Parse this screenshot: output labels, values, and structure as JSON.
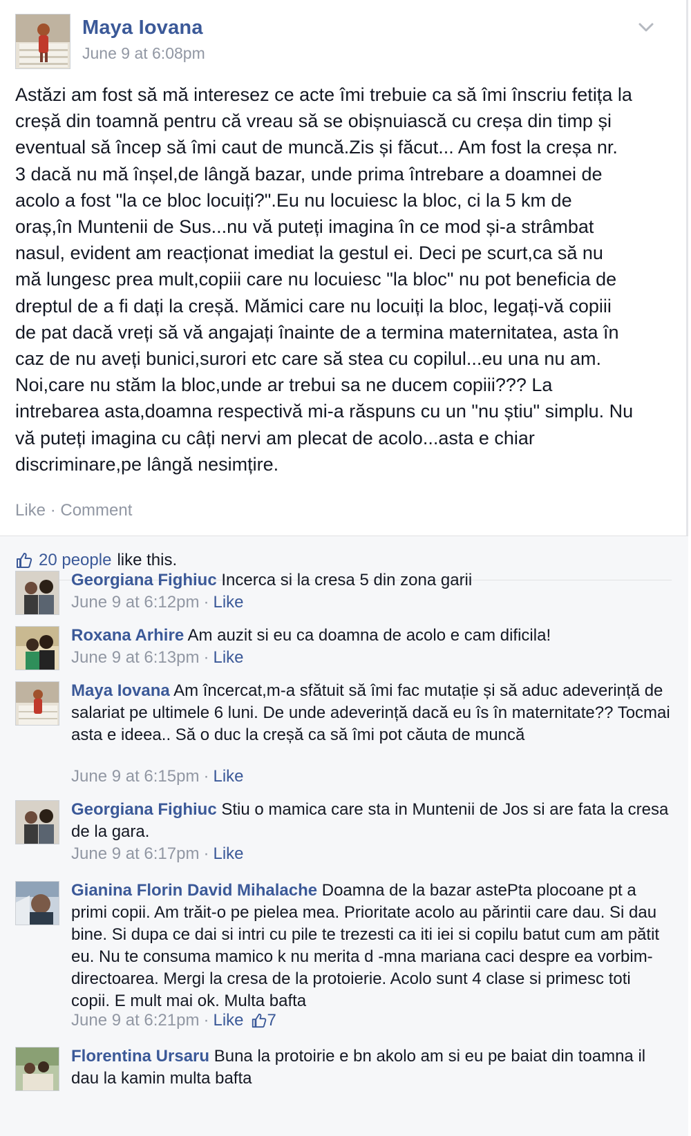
{
  "post": {
    "author": "Maya Iovana",
    "timestamp": "June 9 at 6:08pm",
    "text": "Astăzi am fost să mă interesez ce acte îmi trebuie ca să îmi înscriu fetița la\ncreșă din toamnă pentru că vreau să se obișnuiască cu creșa din timp și\neventual să încep să îmi caut de muncă.Zis și făcut... Am fost la creșa nr.\n3 dacă nu mă înșel,de lângă bazar, unde prima întrebare a doamnei de\nacolo a fost \"la ce bloc locuiți?\".Eu nu locuiesc la bloc, ci la 5 km de\noraș,în Muntenii de Sus...nu vă puteți imagina în ce mod și-a strâmbat\nnasul, evident am reacționat imediat la gestul ei. Deci pe scurt,ca să nu\nmă lungesc prea mult,copiii care nu locuiesc \"la bloc\" nu pot beneficia de\ndreptul de a fi dați la creșă. Mămici care nu locuiți la bloc, legați-vă copiii\nde pat dacă vreți să vă angajați înainte de a termina maternitatea, asta în\ncaz de nu aveți bunici,surori etc care să stea cu copilul...eu una nu am.\nNoi,care nu stăm la bloc,unde ar trebui sa ne ducem copiii??? La\nintrebarea asta,doamna respectivă mi-a răspuns cu un \"nu știu\" simplu. Nu\nvă puteți imagina cu câți nervi am plecat de acolo...asta e chiar\ndiscriminare,pe lângă nesimțire.",
    "actions": {
      "like": "Like",
      "separator": "·",
      "comment": "Comment"
    }
  },
  "likes": {
    "count_label": "20 people",
    "suffix": "like this."
  },
  "comments": [
    {
      "author": "Georgiana Fighiuc",
      "text": "Incerca si la cresa 5 din zona garii",
      "timestamp": "June 9 at 6:12pm",
      "like_label": "Like"
    },
    {
      "author": "Roxana Arhire",
      "text": "Am auzit si eu ca doamna de acolo e cam dificila!",
      "timestamp": "June 9 at 6:13pm",
      "like_label": "Like"
    },
    {
      "author": "Maya Iovana",
      "text": "Am încercat,m-a sfătuit să îmi fac mutație și să aduc adeverință de salariat pe ultimele 6 luni. De unde adeverință dacă eu îs în maternitate?? Tocmai asta e ideea.. Să o duc la creșă ca să îmi pot căuta de muncă",
      "timestamp": "June 9 at 6:15pm",
      "like_label": "Like"
    },
    {
      "author": "Georgiana Fighiuc",
      "text": "Stiu o mamica care sta in Muntenii de Jos si are fata la cresa de la gara.",
      "timestamp": "June 9 at 6:17pm",
      "like_label": "Like"
    },
    {
      "author": "Gianina Florin David Mihalache",
      "text": "Doamna de la bazar astePta plocoane pt a primi copii. Am trăit-o pe pielea mea. Prioritate acolo au părintii care dau. Si dau bine. Si dupa ce dai si intri cu pile te trezesti ca iti iei si copilu batut cum am pătit eu. Nu te consuma mamico k nu merita d -mna mariana caci despre ea vorbim-directoarea. Mergi la cresa de la protoierie. Acolo sunt 4 clase si primesc toti copii. E mult mai ok. Multa bafta",
      "timestamp": "June 9 at 6:21pm",
      "like_label": "Like",
      "like_count": "7"
    },
    {
      "author": "Florentina Ursaru",
      "text": "Buna la protoirie e bn akolo am si eu pe baiat din toamna il dau la kamin multa bafta",
      "timestamp": "",
      "like_label": ""
    }
  ],
  "meta_separator": "·",
  "colors": {
    "link": "#3b5998",
    "muted": "#9197a3",
    "text": "#141823",
    "feedback_bg": "#f6f7f9"
  },
  "icons": [
    "chevron-down-icon",
    "thumbs-up-icon"
  ]
}
